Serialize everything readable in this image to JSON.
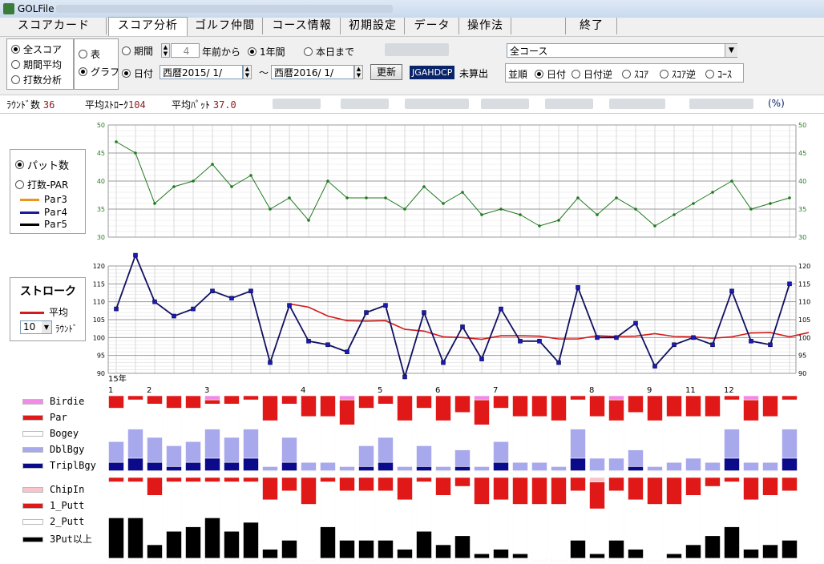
{
  "window": {
    "title": "GOLFile"
  },
  "tabs": [
    {
      "label": "スコアカード",
      "active": false
    },
    {
      "label": "スコア分析",
      "active": true
    },
    {
      "label": "ゴルフ仲間",
      "active": false
    },
    {
      "label": "コース情報",
      "active": false
    },
    {
      "label": "初期設定",
      "active": false
    },
    {
      "label": "データ",
      "active": false
    },
    {
      "label": "操作法",
      "active": false
    },
    {
      "label": "",
      "active": false
    },
    {
      "label": "終了",
      "active": false
    }
  ],
  "controls": {
    "mode_options": [
      "全スコア",
      "期間平均",
      "打数分析"
    ],
    "view_options": [
      "表",
      "グラフ"
    ],
    "period_label": "期間",
    "period_value": "4",
    "years_ago_label": "年前から",
    "one_year_label": "1年間",
    "until_today_label": "本日まで",
    "date_label": "日付",
    "date_from": "西暦2015/ 1/",
    "tilde": "～",
    "date_to": "西暦2016/ 1/",
    "update_button": "更新",
    "jga_badge": "JGAHDCP",
    "jga_status": "未算出",
    "course_select": "全コース",
    "sort_label": "並順",
    "sort_options": [
      "日付",
      "日付逆",
      "ｽｺｱ",
      "ｽｺｱ逆",
      "ｺｰｽ"
    ]
  },
  "stats": {
    "rounds_label": "ﾗｳﾝﾄﾞ数",
    "rounds_value": "36",
    "avg_stroke_label": "平均ｽﾄﾛｰｸ",
    "avg_stroke_value": "104",
    "avg_putt_label": "平均ﾊﾟｯﾄ",
    "avg_putt_value": "37.0",
    "percent_label": "(%)"
  },
  "legend_putts": {
    "options": [
      "パット数",
      "打数-PAR"
    ],
    "lines": [
      {
        "label": "Par3",
        "color": "#e8961e"
      },
      {
        "label": "Par4",
        "color": "#1a1a9a"
      },
      {
        "label": "Par5",
        "color": "#000000"
      }
    ]
  },
  "legend_stroke": {
    "title": "ストローク",
    "avg_label": "平均",
    "avg_color": "#d01c1c",
    "rounds_value": "10",
    "rounds_unit": "ﾗｳﾝﾄﾞ"
  },
  "legend_score": [
    {
      "label": "Birdie",
      "color": "#f08ce8"
    },
    {
      "label": "Par",
      "color": "#e01818"
    },
    {
      "label": "Bogey",
      "color": "#ffffff"
    },
    {
      "label": "DblBgy",
      "color": "#a8a8ec"
    },
    {
      "label": "TriplBgy",
      "color": "#0a0a8a"
    }
  ],
  "legend_putt_types": [
    {
      "label": "ChipIn",
      "color": "#f7c4cc"
    },
    {
      "label": "1_Putt",
      "color": "#e01818"
    },
    {
      "label": "2_Putt",
      "color": "#ffffff"
    },
    {
      "label": "3Put以上",
      "color": "#000000"
    }
  ],
  "chart_data": [
    {
      "type": "line",
      "name": "putts",
      "ylim": [
        30,
        50
      ],
      "yticks": [
        30,
        35,
        40,
        45,
        50
      ],
      "color": "#1f7a1f",
      "values": [
        47,
        45,
        36,
        39,
        40,
        43,
        39,
        41,
        35,
        37,
        33,
        40,
        37,
        37,
        37,
        35,
        39,
        36,
        38,
        34,
        35,
        34,
        32,
        33,
        37,
        34,
        37,
        35,
        32,
        34,
        36,
        38,
        40,
        35,
        36,
        37
      ]
    },
    {
      "type": "line",
      "name": "stroke",
      "ylim": [
        90,
        120
      ],
      "yticks": [
        90,
        95,
        100,
        105,
        110,
        115,
        120
      ],
      "x_month_labels": [
        {
          "round": 1,
          "label": "1",
          "year_label": "15年"
        },
        {
          "round": 3,
          "label": "2"
        },
        {
          "round": 6,
          "label": "3"
        },
        {
          "round": 11,
          "label": "4"
        },
        {
          "round": 15,
          "label": "5"
        },
        {
          "round": 18,
          "label": "6"
        },
        {
          "round": 21,
          "label": "7"
        },
        {
          "round": 26,
          "label": "8"
        },
        {
          "round": 29,
          "label": "9"
        },
        {
          "round": 31,
          "label": "11"
        },
        {
          "round": 33,
          "label": "12"
        }
      ],
      "series": [
        {
          "color": "#101060",
          "values": [
            108,
            123,
            110,
            106,
            108,
            113,
            111,
            113,
            93,
            109,
            99,
            98,
            96,
            107,
            109,
            89,
            107,
            93,
            103,
            94,
            108,
            99,
            99,
            93,
            114,
            100,
            100,
            104,
            92,
            98,
            100,
            98,
            113,
            99,
            98,
            115
          ]
        },
        {
          "name": "平均",
          "color": "#d01c1c",
          "start": 10,
          "values": [
            109.4,
            108.5,
            106.0,
            104.7,
            104.6,
            104.7,
            102.3,
            101.8,
            100.2,
            100.0,
            99.5,
            100.5,
            100.5,
            100.4,
            99.6,
            99.6,
            100.5,
            100.3,
            100.4,
            101.1,
            100.3,
            100.2,
            99.8,
            100.2,
            101.3,
            101.4,
            100.2,
            101.4
          ]
        }
      ]
    }
  ]
}
